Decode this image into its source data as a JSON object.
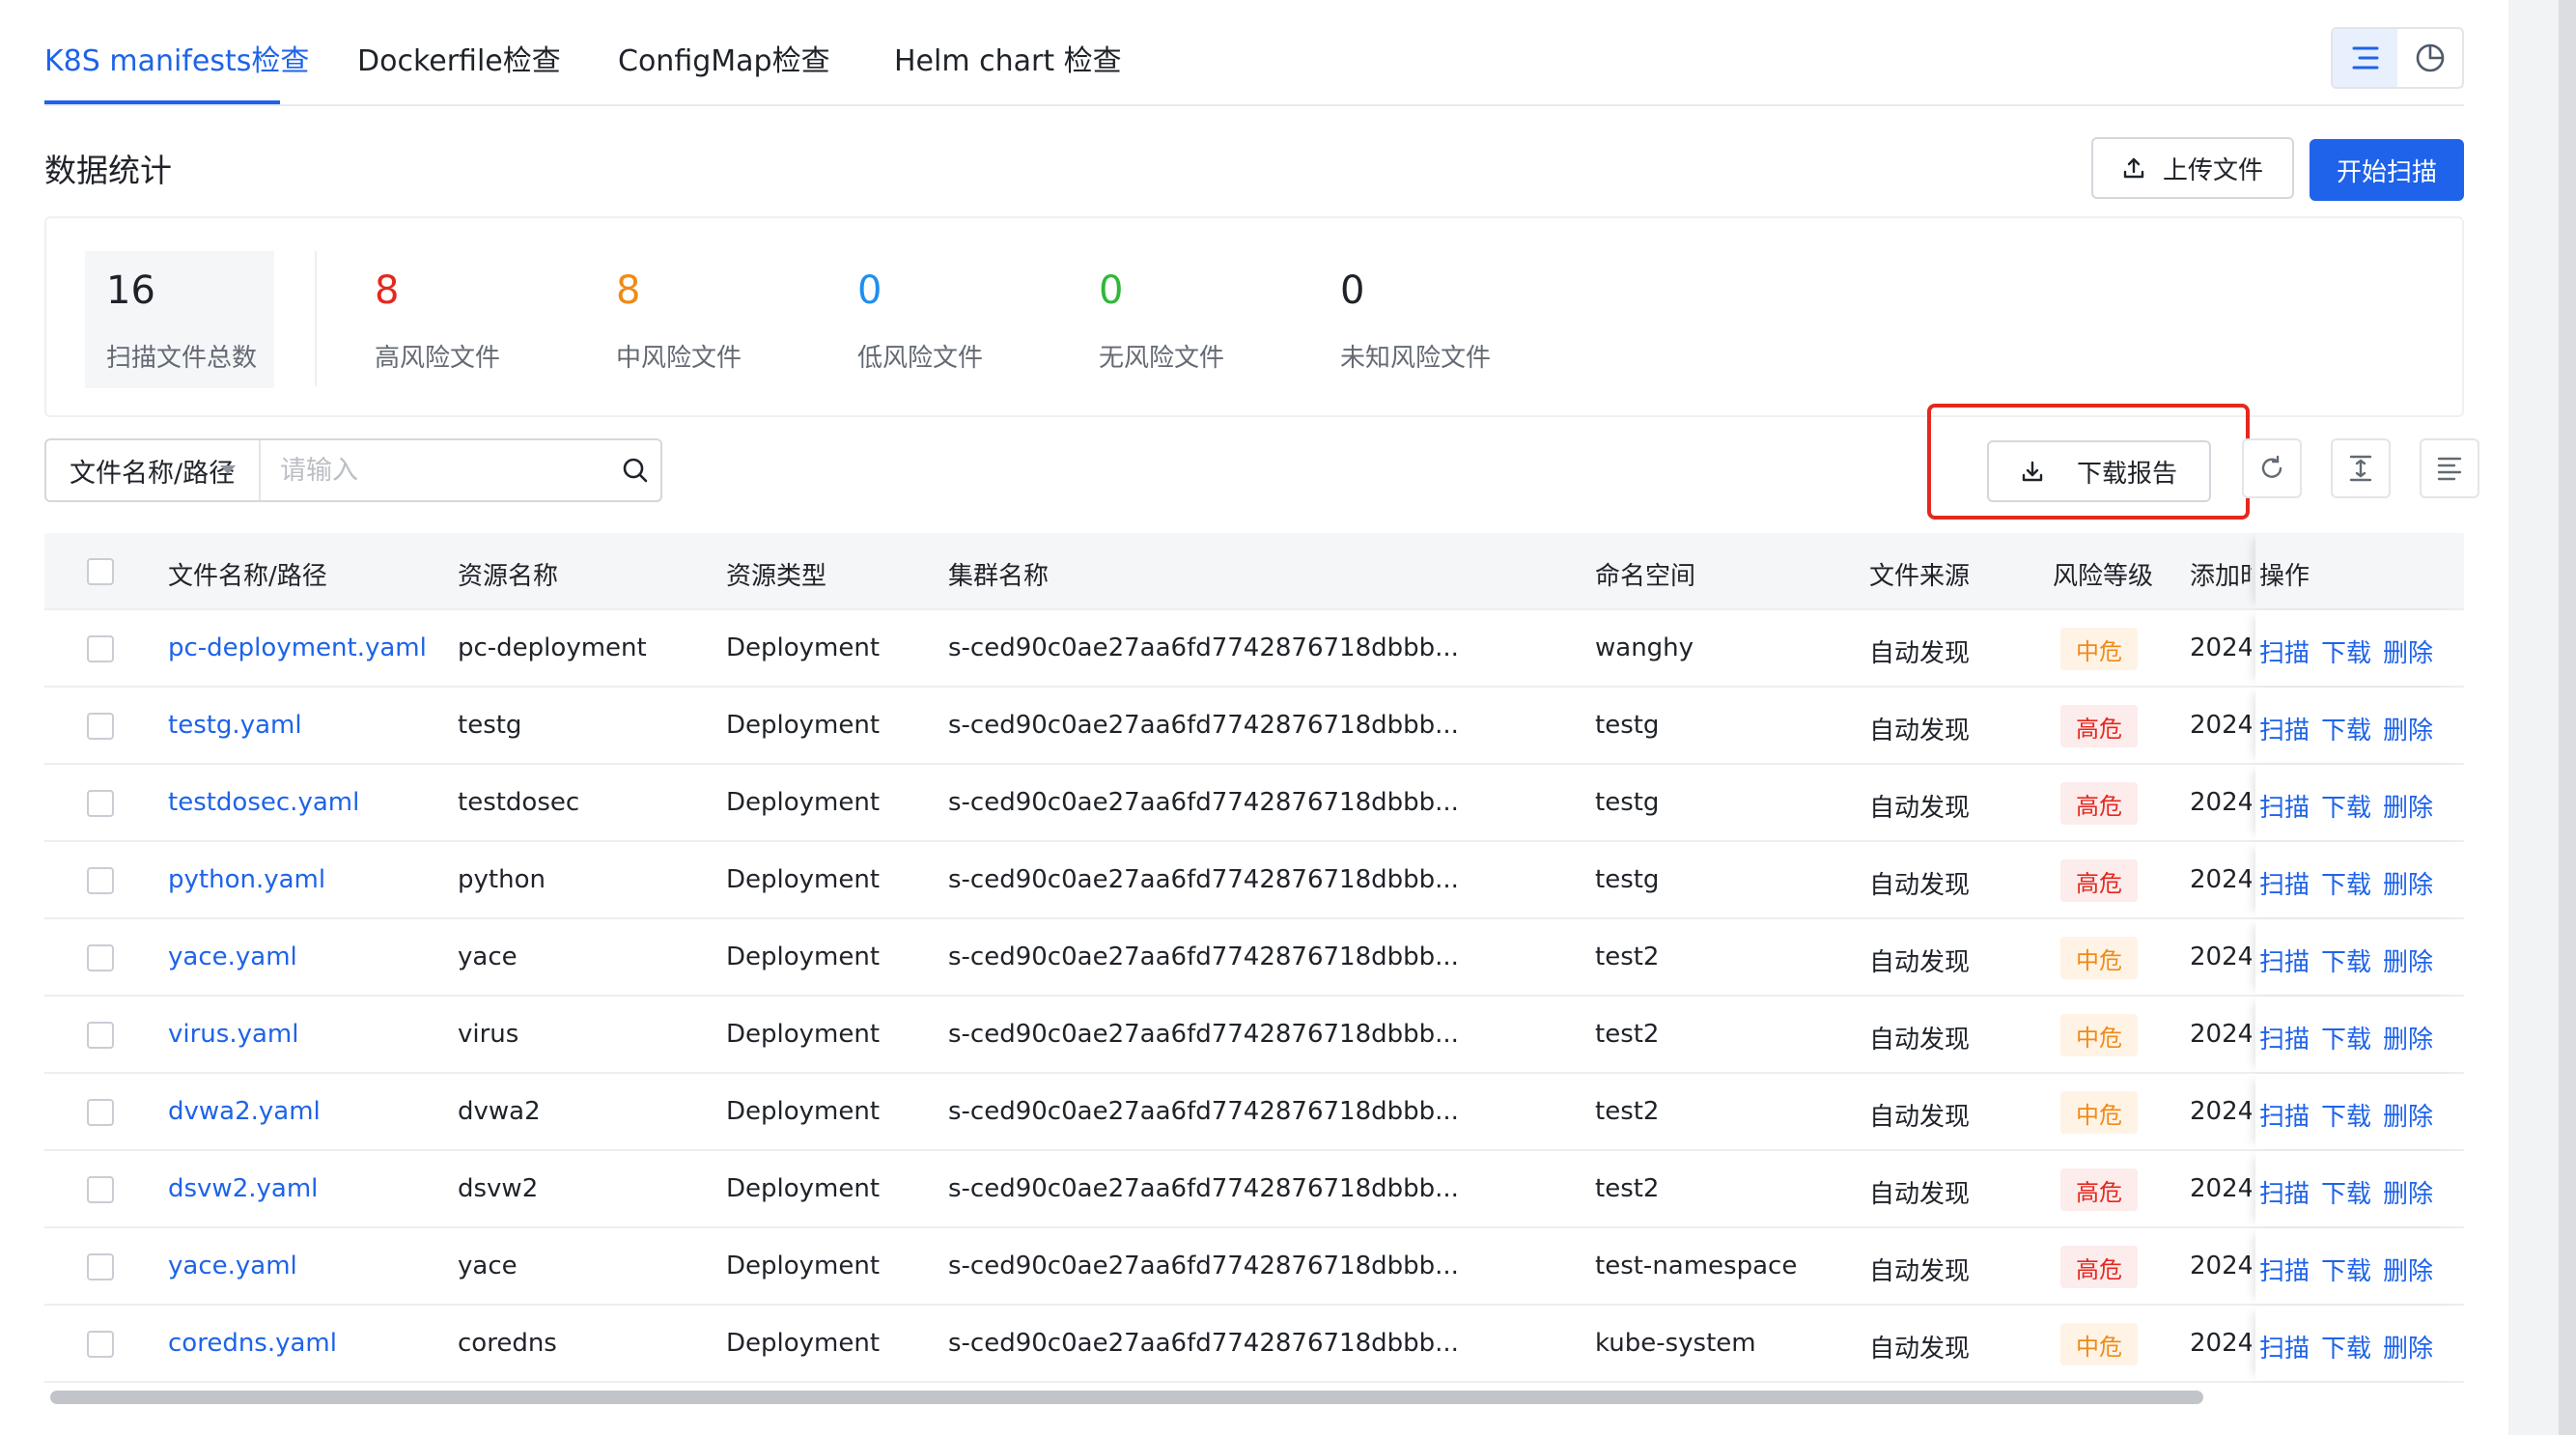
{
  "tabs": [
    {
      "label": "K8S manifests检查",
      "active": true
    },
    {
      "label": "Dockerfile检查",
      "active": false
    },
    {
      "label": "ConfigMap检查",
      "active": false
    },
    {
      "label": "Helm chart 检查",
      "active": false
    }
  ],
  "section_title": "数据统计",
  "actions": {
    "upload_label": "上传文件",
    "scan_label": "开始扫描",
    "download_report_label": "下载报告"
  },
  "stats": [
    {
      "value": "16",
      "label": "扫描文件总数",
      "color": "#1f2329"
    },
    {
      "value": "8",
      "label": "高风险文件",
      "color": "#e5281e"
    },
    {
      "value": "8",
      "label": "中风险文件",
      "color": "#f08a16"
    },
    {
      "value": "0",
      "label": "低风险文件",
      "color": "#1e8ff0"
    },
    {
      "value": "0",
      "label": "无风险文件",
      "color": "#2fb83a"
    },
    {
      "value": "0",
      "label": "未知风险文件",
      "color": "#1f2329"
    }
  ],
  "search": {
    "field_label": "文件名称/路径",
    "placeholder": "请输入"
  },
  "table": {
    "headers": [
      "文件名称/路径",
      "资源名称",
      "资源类型",
      "集群名称",
      "命名空间",
      "文件来源",
      "风险等级",
      "添加时间",
      "操作"
    ],
    "row_actions": [
      "扫描",
      "下载",
      "删除"
    ],
    "rows": [
      {
        "file": "pc-deployment.yaml",
        "resource": "pc-deployment",
        "type": "Deployment",
        "cluster": "s-ced90c0ae27aa6fd7742876718dbbb...",
        "namespace": "wanghy",
        "source": "自动发现",
        "risk": "中危",
        "risk_level": "mid",
        "added": "2024"
      },
      {
        "file": "testg.yaml",
        "resource": "testg",
        "type": "Deployment",
        "cluster": "s-ced90c0ae27aa6fd7742876718dbbb...",
        "namespace": "testg",
        "source": "自动发现",
        "risk": "高危",
        "risk_level": "high",
        "added": "2024"
      },
      {
        "file": "testdosec.yaml",
        "resource": "testdosec",
        "type": "Deployment",
        "cluster": "s-ced90c0ae27aa6fd7742876718dbbb...",
        "namespace": "testg",
        "source": "自动发现",
        "risk": "高危",
        "risk_level": "high",
        "added": "2024"
      },
      {
        "file": "python.yaml",
        "resource": "python",
        "type": "Deployment",
        "cluster": "s-ced90c0ae27aa6fd7742876718dbbb...",
        "namespace": "testg",
        "source": "自动发现",
        "risk": "高危",
        "risk_level": "high",
        "added": "2024"
      },
      {
        "file": "yace.yaml",
        "resource": "yace",
        "type": "Deployment",
        "cluster": "s-ced90c0ae27aa6fd7742876718dbbb...",
        "namespace": "test2",
        "source": "自动发现",
        "risk": "中危",
        "risk_level": "mid",
        "added": "2024"
      },
      {
        "file": "virus.yaml",
        "resource": "virus",
        "type": "Deployment",
        "cluster": "s-ced90c0ae27aa6fd7742876718dbbb...",
        "namespace": "test2",
        "source": "自动发现",
        "risk": "中危",
        "risk_level": "mid",
        "added": "2024"
      },
      {
        "file": "dvwa2.yaml",
        "resource": "dvwa2",
        "type": "Deployment",
        "cluster": "s-ced90c0ae27aa6fd7742876718dbbb...",
        "namespace": "test2",
        "source": "自动发现",
        "risk": "中危",
        "risk_level": "mid",
        "added": "2024"
      },
      {
        "file": "dsvw2.yaml",
        "resource": "dsvw2",
        "type": "Deployment",
        "cluster": "s-ced90c0ae27aa6fd7742876718dbbb...",
        "namespace": "test2",
        "source": "自动发现",
        "risk": "高危",
        "risk_level": "high",
        "added": "2024"
      },
      {
        "file": "yace.yaml",
        "resource": "yace",
        "type": "Deployment",
        "cluster": "s-ced90c0ae27aa6fd7742876718dbbb...",
        "namespace": "test-namespace",
        "source": "自动发现",
        "risk": "高危",
        "risk_level": "high",
        "added": "2024"
      },
      {
        "file": "coredns.yaml",
        "resource": "coredns",
        "type": "Deployment",
        "cluster": "s-ced90c0ae27aa6fd7742876718dbbb...",
        "namespace": "kube-system",
        "source": "自动发现",
        "risk": "中危",
        "risk_level": "mid",
        "added": "2024"
      }
    ]
  },
  "icons": {
    "list_view": "list-view-icon",
    "chart_view": "pie-chart-icon",
    "upload": "upload-icon",
    "download": "download-icon",
    "search": "search-icon",
    "refresh": "refresh-icon",
    "density": "density-icon",
    "columns": "columns-setting-icon"
  },
  "colors": {
    "accent": "#1e63e9",
    "highlight": "#e5281e"
  }
}
